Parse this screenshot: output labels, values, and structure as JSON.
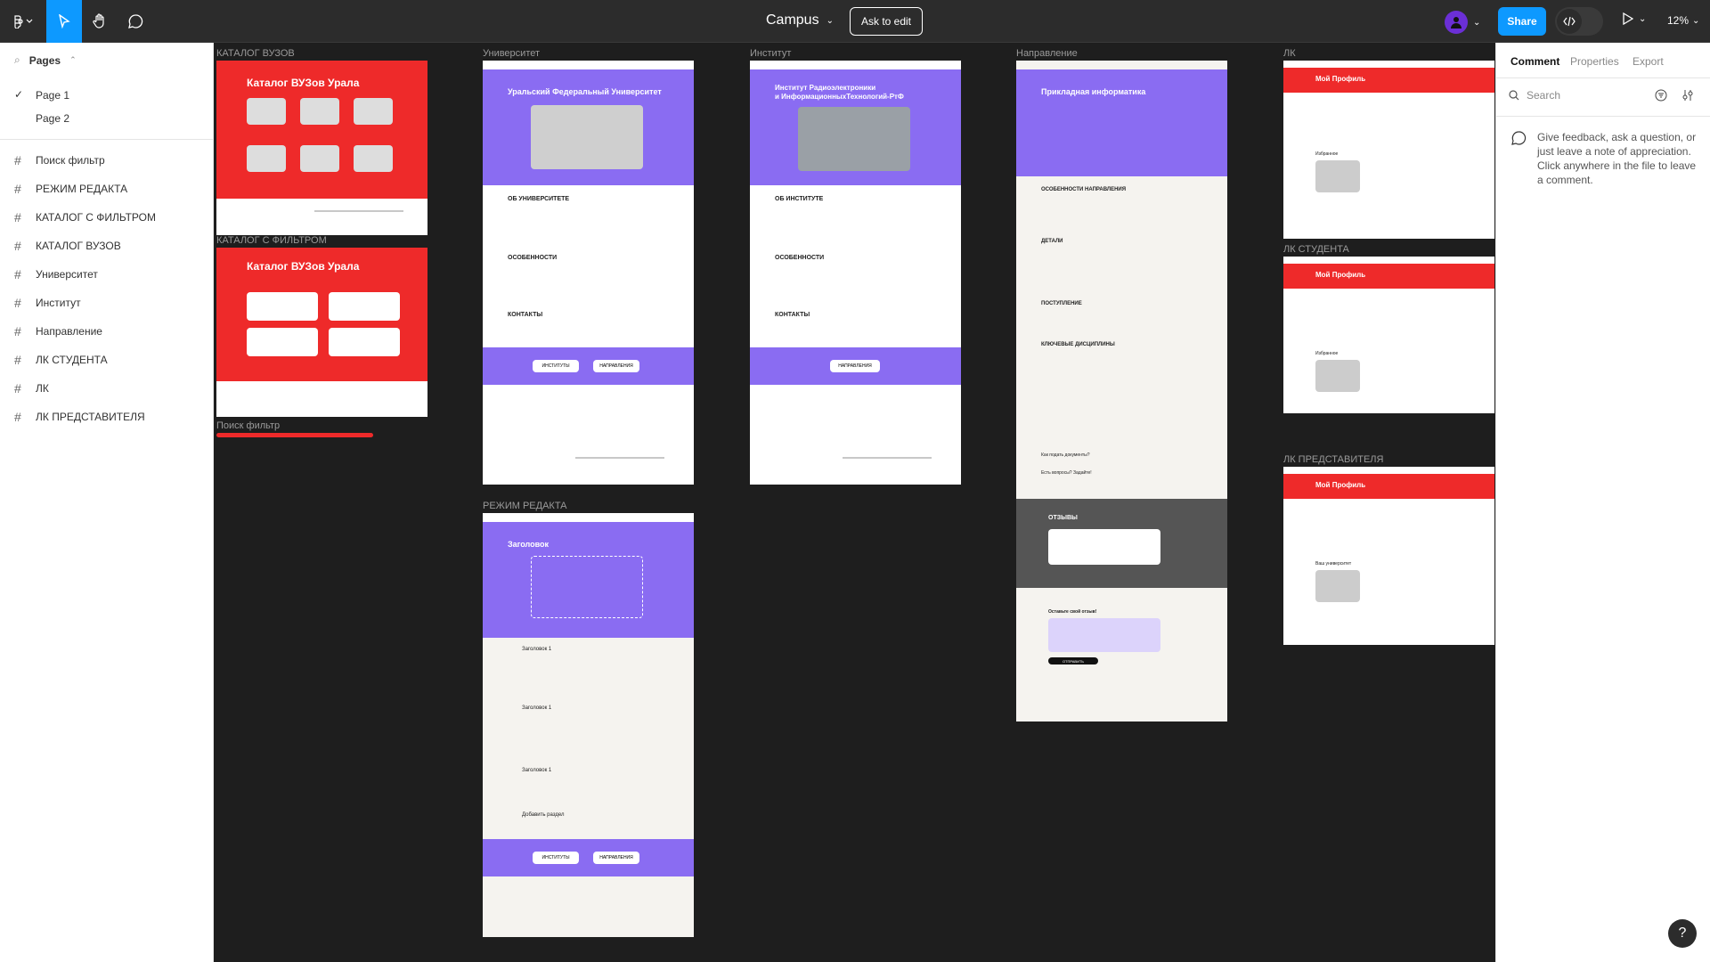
{
  "topbar": {
    "file_title": "Campus",
    "ask_to_edit": "Ask to edit",
    "share": "Share",
    "zoom": "12%",
    "icons": [
      "figma-menu-icon",
      "move-tool-icon",
      "hand-tool-icon",
      "comment-tool-icon",
      "play-icon",
      "code-icon"
    ]
  },
  "leftpanel": {
    "pages_label": "Pages",
    "pages": [
      "Page 1",
      "Page 2"
    ],
    "layers": [
      "Поиск фильтр",
      "РЕЖИМ РЕДАКТА",
      "КАТАЛОГ С ФИЛЬТРОМ",
      "КАТАЛОГ ВУЗОВ",
      "Университет",
      "Институт",
      "Направление",
      "ЛК СТУДЕНТА",
      "ЛК",
      "ЛК ПРЕДСТАВИТЕЛЯ"
    ]
  },
  "canvas": {
    "frames": {
      "catalog": {
        "label": "КАТАЛОГ ВУЗОВ",
        "title": "Каталог ВУЗов Урала"
      },
      "catalog_filter": {
        "label": "КАТАЛОГ С ФИЛЬТРОМ",
        "title": "Каталог ВУЗов Урала"
      },
      "search_filter": {
        "label": "Поиск фильтр"
      },
      "university": {
        "label": "Университет",
        "title": "Уральский Федеральный Университет",
        "sections": [
          "ОБ УНИВЕРСИТЕТЕ",
          "ОСОБЕННОСТИ",
          "КОНТАКТЫ"
        ],
        "buttons": [
          "ИНСТИТУТЫ",
          "НАПРАВЛЕНИЯ"
        ]
      },
      "institute": {
        "label": "Институт",
        "title_1": "Институт Радиоэлектроники",
        "title_2": "и ИнформационныхТехнологий-РтФ",
        "sections": [
          "ОБ ИНСТИТУТЕ",
          "ОСОБЕННОСТИ",
          "КОНТАКТЫ"
        ],
        "buttons": [
          "НАПРАВЛЕНИЯ"
        ]
      },
      "direction": {
        "label": "Направление",
        "title": "Прикладная информатика",
        "sections": [
          "ОСОБЕННОСТИ НАПРАВЛЕНИЯ",
          "ДЕТАЛИ",
          "ПОСТУПЛЕНИЕ",
          "КЛЮЧЕВЫЕ ДИСЦИПЛИНЫ"
        ],
        "reviews": "ОТЗЫВЫ",
        "leave_review": "Оставьте свой отзыв!",
        "send": "ОТПРАВИТЬ",
        "how_to_apply": "Как подать документы?",
        "questions": "Есть вопросы? Задайте!"
      },
      "edit_mode": {
        "label": "РЕЖИМ РЕДАКТА",
        "heading": "Заголовок",
        "sub_heading": "Заголовок 1",
        "add_section": "Добавить раздел",
        "buttons": [
          "ИНСТИТУТЫ",
          "НАПРАВЛЕНИЯ"
        ]
      },
      "lk": {
        "label": "ЛК",
        "title": "Мой Профиль",
        "favorites": "Избранное"
      },
      "lk_student": {
        "label": "ЛК СТУДЕНТА",
        "title": "Мой Профиль",
        "favorites": "Избранное"
      },
      "lk_rep": {
        "label": "ЛК ПРЕДСТАВИТЕЛЯ",
        "title": "Мой Профиль",
        "my_university": "Ваш университет"
      }
    }
  },
  "rightpanel": {
    "tabs": [
      "Comment",
      "Properties",
      "Export"
    ],
    "search_placeholder": "Search",
    "hint": "Give feedback, ask a question, or just leave a note of appreciation. Click anywhere in the file to leave a comment."
  },
  "colors": {
    "accent": "#0d99ff",
    "brand_red": "#ee2a2a",
    "brand_purple": "#8a6cf2",
    "canvas": "#1e1e1e"
  }
}
